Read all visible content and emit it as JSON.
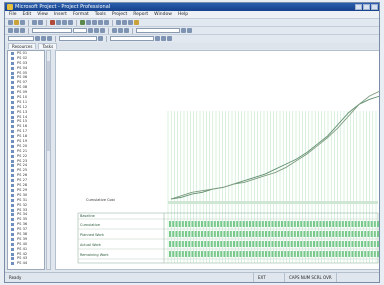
{
  "window": {
    "title": "Microsoft Project - Project Professional"
  },
  "menu": [
    "File",
    "Edit",
    "View",
    "Insert",
    "Format",
    "Tools",
    "Project",
    "Report",
    "Window",
    "Help"
  ],
  "toolbar": {
    "field_a": "",
    "field_b": "",
    "field_c": ""
  },
  "tabs": [
    "Resources",
    "Tasks"
  ],
  "tree": {
    "items": [
      "PS 01",
      "PS 02",
      "PS 03",
      "PS 04",
      "PS 05",
      "PS 06",
      "PS 07",
      "PS 08",
      "PS 09",
      "PS 10",
      "PS 11",
      "PS 12",
      "PS 13",
      "PS 14",
      "PS 15",
      "PS 16",
      "PS 17",
      "PS 18",
      "PS 19",
      "PS 20",
      "PS 21",
      "PS 22",
      "PS 23",
      "PS 24",
      "PS 25",
      "PS 26",
      "PS 27",
      "PS 28",
      "PS 29",
      "PS 30",
      "PS 31",
      "PS 32",
      "PS 33",
      "PS 34",
      "PS 35",
      "PS 36",
      "PS 37",
      "PS 38",
      "PS 39",
      "PS 40",
      "PS 41",
      "PS 42",
      "PS 43",
      "PS 44"
    ]
  },
  "chart": {
    "legend_label": "Cumulative Cost",
    "table_rows": [
      "Baseline",
      "Cumulative",
      "Planned Work",
      "Actual Work",
      "Remaining Work"
    ]
  },
  "chart_data": {
    "type": "line",
    "x": [
      0,
      1,
      2,
      3,
      4,
      5,
      6,
      7,
      8,
      9,
      10,
      11,
      12,
      13,
      14,
      15,
      16,
      17,
      18,
      19,
      20
    ],
    "series": [
      {
        "values": [
          0,
          1,
          3,
          4,
          6,
          7,
          9,
          11,
          13,
          15,
          18,
          21,
          24,
          28,
          33,
          38,
          45,
          52,
          57,
          60,
          62
        ]
      },
      {
        "values": [
          0,
          2,
          4,
          5,
          6,
          7,
          9,
          10,
          12,
          14,
          16,
          19,
          23,
          27,
          32,
          37,
          43,
          50,
          57,
          62,
          65
        ]
      }
    ],
    "colors": [
      "#5f8f6f",
      "#7e9c7f"
    ]
  },
  "status": {
    "left": "Ready",
    "mid": "EXT",
    "right": "CAPS  NUM  SCRL  OVR"
  }
}
